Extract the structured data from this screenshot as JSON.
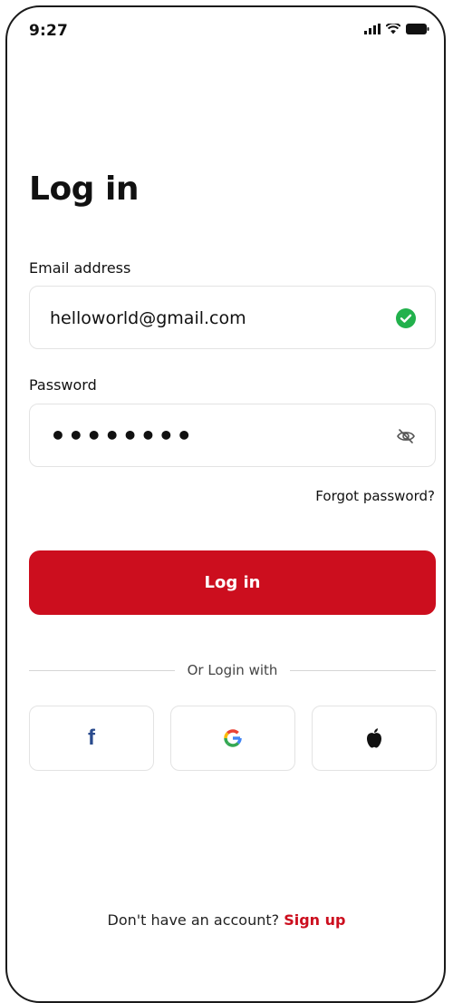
{
  "status_bar": {
    "time": "9:27",
    "icons": [
      "signal-icon",
      "wifi-icon",
      "battery-icon"
    ]
  },
  "page": {
    "title": "Log in"
  },
  "email": {
    "label": "Email address",
    "value": "helloworld@gmail.com",
    "status_icon": "check-circle-icon",
    "status_color": "#22b14c"
  },
  "password": {
    "label": "Password",
    "value": "••••••••",
    "toggle_icon": "eye-off-icon"
  },
  "forgot_password": {
    "label": "Forgot password?"
  },
  "login_button": {
    "label": "Log in",
    "color": "#cc0e1e"
  },
  "divider": {
    "label": "Or Login with"
  },
  "social_buttons": [
    {
      "name": "facebook",
      "icon": "facebook-icon",
      "glyph": "f",
      "color": "#2a4b8d"
    },
    {
      "name": "google",
      "icon": "google-icon"
    },
    {
      "name": "apple",
      "icon": "apple-icon"
    }
  ],
  "signup": {
    "prompt": "Don't have an account?",
    "link": "Sign up",
    "link_color": "#cc0e1e"
  }
}
